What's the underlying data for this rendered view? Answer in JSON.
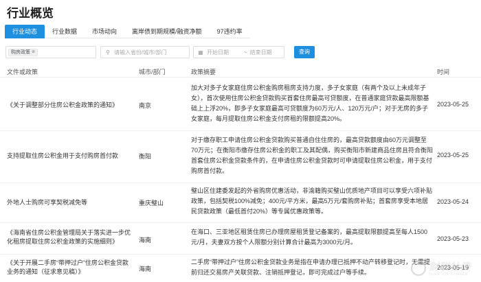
{
  "page": {
    "title": "行业概览"
  },
  "tabs": [
    {
      "label": "行业动态",
      "active": true
    },
    {
      "label": "行业数据",
      "active": false
    },
    {
      "label": "市场动向",
      "active": false
    },
    {
      "label": "离岸债到期规模/融资净额",
      "active": false
    },
    {
      "label": "97违约率",
      "active": false
    }
  ],
  "filters": {
    "category_tag": "购房政策",
    "search_placeholder": "请输入省份/城市/部门",
    "start_date_placeholder": "开始日期",
    "date_separator": "~",
    "end_date_placeholder": "结束日期",
    "query_button": "查询"
  },
  "table": {
    "headers": {
      "title": "文件或政策",
      "city": "城市/部门",
      "summary": "政策摘要",
      "time": "时间"
    },
    "rows": [
      {
        "title": "《关于调整部分住房公积金政策的通知》",
        "city": "南京",
        "summary": "加大对多子女家庭住房公积金购房租房支持力度，多子女家庭（有两个及以上未成年子女），首次使用住房公积金贷款购买首套住房最高可贷额度，在普通家庭贷款最高限额基础上上浮20%，即多子女家庭最高可贷额度为60万元/人、120万元/户；对于无房的多子女家庭，每月提取住房公积金支付房租的限额提高20%。",
        "time": "2023-05-25"
      },
      {
        "title": "支持提取住房公积金用于支付购房首付款",
        "city": "衡阳",
        "summary": "对于缴存职工申请住房公积金贷款购买普通自住住房的，最高贷款额度由60万元调整至70万元；在衡阳市缴存住房公积金的职工及其配偶，购买衡阳市新建商品住房且符合衡阳首套住房公积金贷款条件的，在申请住房公积金贷款时可申请提取住房公积金，用于支付购房首付款。",
        "time": "2023-05-25"
      },
      {
        "title": "外地人士购房可享契税减免等",
        "city": "重庆璧山",
        "summary": "璧山区住建委发起的外省购房优惠活动，非渝籍购买璧山优质地产项目可以享受六项补贴政策，包括契税100%减免；400元/平方米，最高5万元/套购房补贴；首套房享受本地居民贷款政策（最低首付20%）等专属优惠政策等。",
        "time": "2023-05-24"
      },
      {
        "title": "《海南省住房公积金管理局关于落实进一步优化租房提取住房公积金政策的实施细则》",
        "city": "海南",
        "summary": "在海口、三亚地区租赁住房已办理房屋租赁登记备案的，最高提取限额提高至每人1500元/月，夫妻双方按个人限额分别计算合计最高为3000元/月。",
        "time": "2023-05-23"
      },
      {
        "title": "《关于开展二手房“带押过户”住房公积金贷款业务的通知（征求意见稿）》",
        "city": "海南",
        "summary": "二手房“带押过户”住房公积金贷款业务是指在申请办理已抵押不动产转移登记时，无需提前归还交易房产关联贷款、注销抵押登记，即可完成过户等手续。",
        "time": "2023-05-19"
      }
    ]
  },
  "watermark": {
    "text": "财联社债",
    "sub": "DURATION FINANCE"
  },
  "colors": {
    "accent": "#1f8fe0",
    "border": "#eeeeee"
  }
}
